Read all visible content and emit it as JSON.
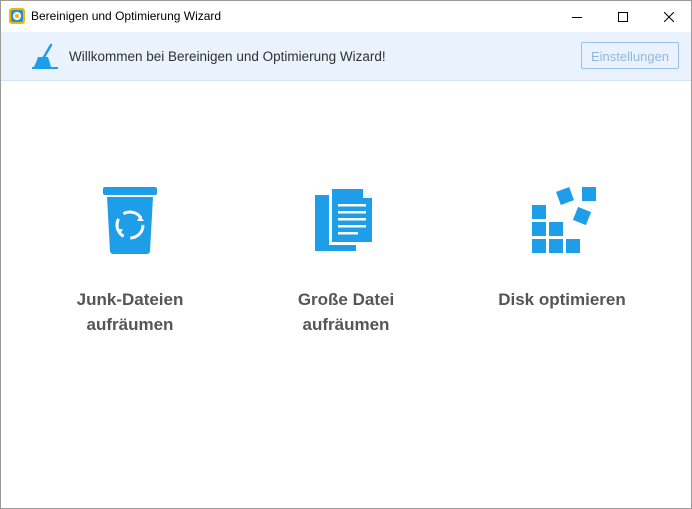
{
  "window": {
    "title": "Bereinigen und Optimierung Wizard",
    "controls": [
      "minimize",
      "maximize",
      "close"
    ]
  },
  "banner": {
    "welcome_text": "Willkommen bei Bereinigen und Optimierung Wizard!",
    "settings_label": "Einstellungen",
    "icon": "broom-icon"
  },
  "features": [
    {
      "label_line1": "Junk-Dateien",
      "label_line2": "aufräumen",
      "icon": "recycle-bin-icon"
    },
    {
      "label_line1": "Große Datei",
      "label_line2": "aufräumen",
      "icon": "documents-icon"
    },
    {
      "label_line1": "Disk optimieren",
      "label_line2": "",
      "icon": "disk-blocks-icon"
    }
  ],
  "colors": {
    "accent": "#1e9ee8",
    "banner_bg": "#eaf3fd",
    "label": "#555555"
  }
}
